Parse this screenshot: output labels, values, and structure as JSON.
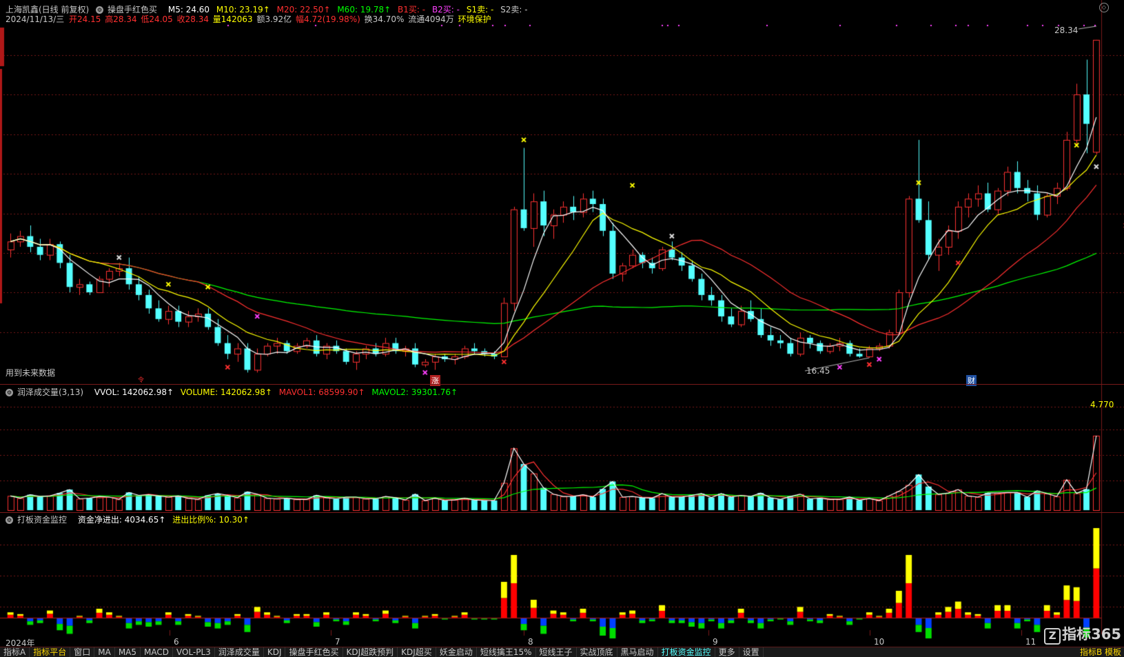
{
  "header": {
    "stock_name": "上海凯鑫(日线 前复权)",
    "indicator": "操盘手红色买",
    "m5": "M5: 24.60",
    "m10": "M10: 23.19↑",
    "m20": "M20: 22.50↑",
    "m60": "M60: 19.78↑",
    "b1": "B1买: -",
    "b2": "B2买: -",
    "s1": "S1卖: -",
    "s2": "S2卖: -",
    "date": "2024/11/13/三",
    "open": "开24.15",
    "high": "高28.34",
    "low": "低24.05",
    "close": "收28.34",
    "volume": "量142063",
    "amount": "额3.92亿",
    "change": "幅4.72(19.98%)",
    "turnover": "换34.70%",
    "float": "流通4094万",
    "env": "环境保护",
    "future_note": "用到未来数据",
    "high_label": "28.34",
    "low_label": "16.45",
    "marker_zhang": "涨",
    "marker_cai": "财",
    "marker_left": "令"
  },
  "volume_pane": {
    "title": "润泽成交量(3,13)",
    "vvol": "VVOL: 142062.98↑",
    "volume": "VOLUME: 142062.98↑",
    "mavol1": "MAVOL1: 68599.90↑",
    "mavol2": "MAVOL2: 39301.76↑",
    "max_label": "4.770"
  },
  "money_pane": {
    "title": "打板资金监控",
    "net": "资金净进出: 4034.65↑",
    "ratio": "进出比例%: 10.30↑"
  },
  "x_axis": {
    "labels": [
      "2024年",
      "6",
      "7",
      "8",
      "9",
      "10",
      "11"
    ]
  },
  "tabs": [
    "指标A",
    "指标平台",
    "窗口",
    "MA",
    "MA5",
    "MACD",
    "VOL-PL3",
    "润泽成交量",
    "KDJ",
    "操盘手红色买",
    "KDJ超跌预判",
    "KDJ超买",
    "妖金启动",
    "短线擒王15%",
    "短线王子",
    "实战顶底",
    "黑马启动",
    "打板资金监控",
    "更多",
    "设置"
  ],
  "active_tab": 1,
  "right_tabs": "指标B 模板",
  "logo_text": "指标365",
  "colors": {
    "up": "#ff3232",
    "down": "#54ffff",
    "ma5": "#ffffff",
    "ma10": "#ffff00",
    "ma20": "#ff3030",
    "ma60": "#00ff00",
    "money_yellow": "#ffff00",
    "money_red": "#ff0000",
    "money_blue": "#0040ff",
    "money_green": "#00dd00",
    "grid": "#7a1a1a"
  },
  "chart_data": {
    "type": "candlestick",
    "x": [
      "2024-05",
      "2024-06",
      "2024-07",
      "2024-08",
      "2024-09",
      "2024-10",
      "2024-11"
    ],
    "ohlc": [
      [
        20.5,
        21.1,
        20.2,
        20.8
      ],
      [
        20.8,
        21.2,
        20.6,
        21.0
      ],
      [
        21.0,
        21.4,
        20.4,
        20.6
      ],
      [
        20.6,
        20.9,
        20.1,
        20.3
      ],
      [
        20.3,
        20.9,
        20.1,
        20.7
      ],
      [
        20.7,
        20.8,
        19.8,
        20.0
      ],
      [
        20.0,
        20.3,
        18.9,
        19.1
      ],
      [
        19.1,
        19.4,
        18.8,
        19.2
      ],
      [
        19.2,
        19.3,
        18.8,
        18.9
      ],
      [
        18.9,
        19.5,
        18.9,
        19.4
      ],
      [
        19.4,
        19.8,
        19.1,
        19.7
      ],
      [
        19.7,
        20.0,
        19.5,
        19.8
      ],
      [
        19.8,
        20.2,
        19.0,
        19.2
      ],
      [
        19.2,
        19.5,
        18.6,
        18.8
      ],
      [
        18.8,
        19.0,
        18.1,
        18.3
      ],
      [
        18.3,
        18.6,
        17.8,
        17.9
      ],
      [
        17.9,
        18.4,
        17.7,
        18.2
      ],
      [
        18.2,
        18.4,
        17.6,
        17.8
      ],
      [
        17.8,
        18.2,
        17.6,
        18.0
      ],
      [
        18.0,
        18.3,
        17.8,
        18.1
      ],
      [
        18.1,
        18.3,
        17.5,
        17.6
      ],
      [
        17.6,
        17.9,
        16.9,
        17.0
      ],
      [
        17.0,
        17.3,
        16.4,
        16.6
      ],
      [
        16.6,
        17.0,
        16.3,
        16.8
      ],
      [
        16.8,
        17.0,
        15.9,
        16.0
      ],
      [
        16.0,
        16.8,
        15.9,
        16.6
      ],
      [
        16.6,
        17.0,
        16.5,
        16.9
      ],
      [
        16.9,
        17.2,
        16.6,
        17.0
      ],
      [
        17.0,
        17.1,
        16.6,
        16.7
      ],
      [
        16.7,
        17.0,
        16.6,
        16.9
      ],
      [
        16.9,
        17.2,
        16.8,
        17.1
      ],
      [
        17.1,
        17.3,
        16.5,
        16.6
      ],
      [
        16.6,
        17.0,
        16.4,
        16.9
      ],
      [
        16.9,
        17.1,
        16.6,
        16.7
      ],
      [
        16.7,
        16.8,
        16.2,
        16.3
      ],
      [
        16.3,
        16.7,
        16.0,
        16.6
      ],
      [
        16.6,
        16.9,
        16.4,
        16.8
      ],
      [
        16.8,
        17.0,
        16.5,
        16.6
      ],
      [
        16.6,
        17.2,
        16.5,
        17.0
      ],
      [
        17.0,
        17.2,
        16.6,
        16.7
      ],
      [
        16.7,
        16.9,
        16.5,
        16.8
      ],
      [
        16.8,
        17.0,
        16.1,
        16.2
      ],
      [
        16.2,
        16.4,
        16.1,
        16.3
      ],
      [
        16.3,
        16.6,
        16.0,
        16.5
      ],
      [
        16.5,
        16.6,
        16.3,
        16.4
      ],
      [
        16.4,
        16.6,
        16.2,
        16.5
      ],
      [
        16.5,
        16.9,
        16.4,
        16.8
      ],
      [
        16.8,
        17.0,
        16.6,
        16.7
      ],
      [
        16.7,
        16.8,
        16.5,
        16.6
      ],
      [
        16.6,
        16.7,
        16.4,
        16.5
      ],
      [
        16.5,
        18.7,
        16.5,
        18.5
      ],
      [
        18.5,
        22.1,
        18.2,
        22.0
      ],
      [
        22.0,
        24.3,
        21.2,
        21.3
      ],
      [
        21.3,
        22.6,
        20.6,
        22.3
      ],
      [
        22.3,
        22.7,
        21.0,
        21.4
      ],
      [
        21.4,
        22.0,
        20.9,
        21.8
      ],
      [
        21.8,
        22.3,
        21.5,
        22.1
      ],
      [
        22.1,
        22.5,
        21.6,
        21.9
      ],
      [
        21.9,
        22.6,
        21.7,
        22.4
      ],
      [
        22.4,
        22.7,
        21.9,
        22.2
      ],
      [
        22.2,
        22.4,
        21.0,
        21.2
      ],
      [
        21.2,
        21.5,
        19.4,
        19.6
      ],
      [
        19.6,
        20.0,
        19.3,
        19.9
      ],
      [
        19.9,
        20.5,
        19.8,
        20.3
      ],
      [
        20.3,
        20.4,
        19.8,
        20.0
      ],
      [
        20.0,
        20.2,
        19.6,
        19.8
      ],
      [
        19.8,
        20.6,
        19.7,
        20.5
      ],
      [
        20.5,
        20.8,
        20.1,
        20.2
      ],
      [
        20.2,
        20.4,
        19.7,
        19.9
      ],
      [
        19.9,
        20.1,
        19.3,
        19.4
      ],
      [
        19.4,
        19.6,
        18.6,
        18.8
      ],
      [
        18.8,
        19.1,
        18.4,
        18.6
      ],
      [
        18.6,
        18.8,
        17.8,
        18.0
      ],
      [
        18.0,
        18.3,
        17.6,
        17.7
      ],
      [
        17.7,
        18.4,
        17.6,
        18.2
      ],
      [
        18.2,
        18.6,
        17.8,
        17.9
      ],
      [
        17.9,
        18.3,
        17.2,
        17.3
      ],
      [
        17.3,
        17.6,
        16.9,
        17.1
      ],
      [
        17.1,
        17.3,
        16.8,
        17.0
      ],
      [
        17.0,
        17.2,
        16.5,
        16.6
      ],
      [
        16.6,
        17.4,
        16.5,
        17.2
      ],
      [
        17.2,
        17.3,
        16.8,
        17.0
      ],
      [
        17.0,
        17.1,
        16.6,
        16.7
      ],
      [
        16.7,
        17.0,
        16.6,
        16.9
      ],
      [
        16.9,
        17.2,
        16.7,
        17.0
      ],
      [
        17.0,
        17.1,
        16.5,
        16.6
      ],
      [
        16.6,
        16.8,
        16.45,
        16.5
      ],
      [
        16.5,
        16.9,
        16.45,
        16.8
      ],
      [
        16.8,
        17.0,
        16.7,
        16.9
      ],
      [
        16.9,
        17.5,
        16.8,
        17.4
      ],
      [
        17.4,
        19.0,
        17.3,
        18.9
      ],
      [
        18.9,
        22.5,
        18.7,
        22.4
      ],
      [
        22.4,
        24.6,
        21.5,
        21.6
      ],
      [
        21.6,
        22.3,
        20.1,
        20.3
      ],
      [
        20.3,
        20.9,
        19.7,
        20.6
      ],
      [
        20.6,
        21.4,
        20.3,
        21.2
      ],
      [
        21.2,
        22.3,
        20.9,
        22.1
      ],
      [
        22.1,
        22.6,
        21.7,
        22.4
      ],
      [
        22.4,
        22.9,
        22.1,
        22.6
      ],
      [
        22.6,
        23.0,
        21.9,
        22.0
      ],
      [
        22.0,
        22.8,
        21.8,
        22.7
      ],
      [
        22.7,
        23.6,
        22.5,
        23.4
      ],
      [
        23.4,
        23.8,
        22.6,
        22.8
      ],
      [
        22.8,
        23.1,
        22.3,
        22.6
      ],
      [
        22.6,
        22.9,
        21.6,
        21.8
      ],
      [
        21.8,
        22.6,
        21.7,
        22.5
      ],
      [
        22.5,
        23.0,
        22.2,
        22.8
      ],
      [
        22.8,
        24.9,
        22.7,
        24.6
      ],
      [
        24.6,
        26.7,
        24.4,
        26.3
      ],
      [
        26.3,
        27.6,
        24.1,
        25.2
      ],
      [
        24.15,
        28.34,
        24.05,
        28.34
      ]
    ]
  }
}
